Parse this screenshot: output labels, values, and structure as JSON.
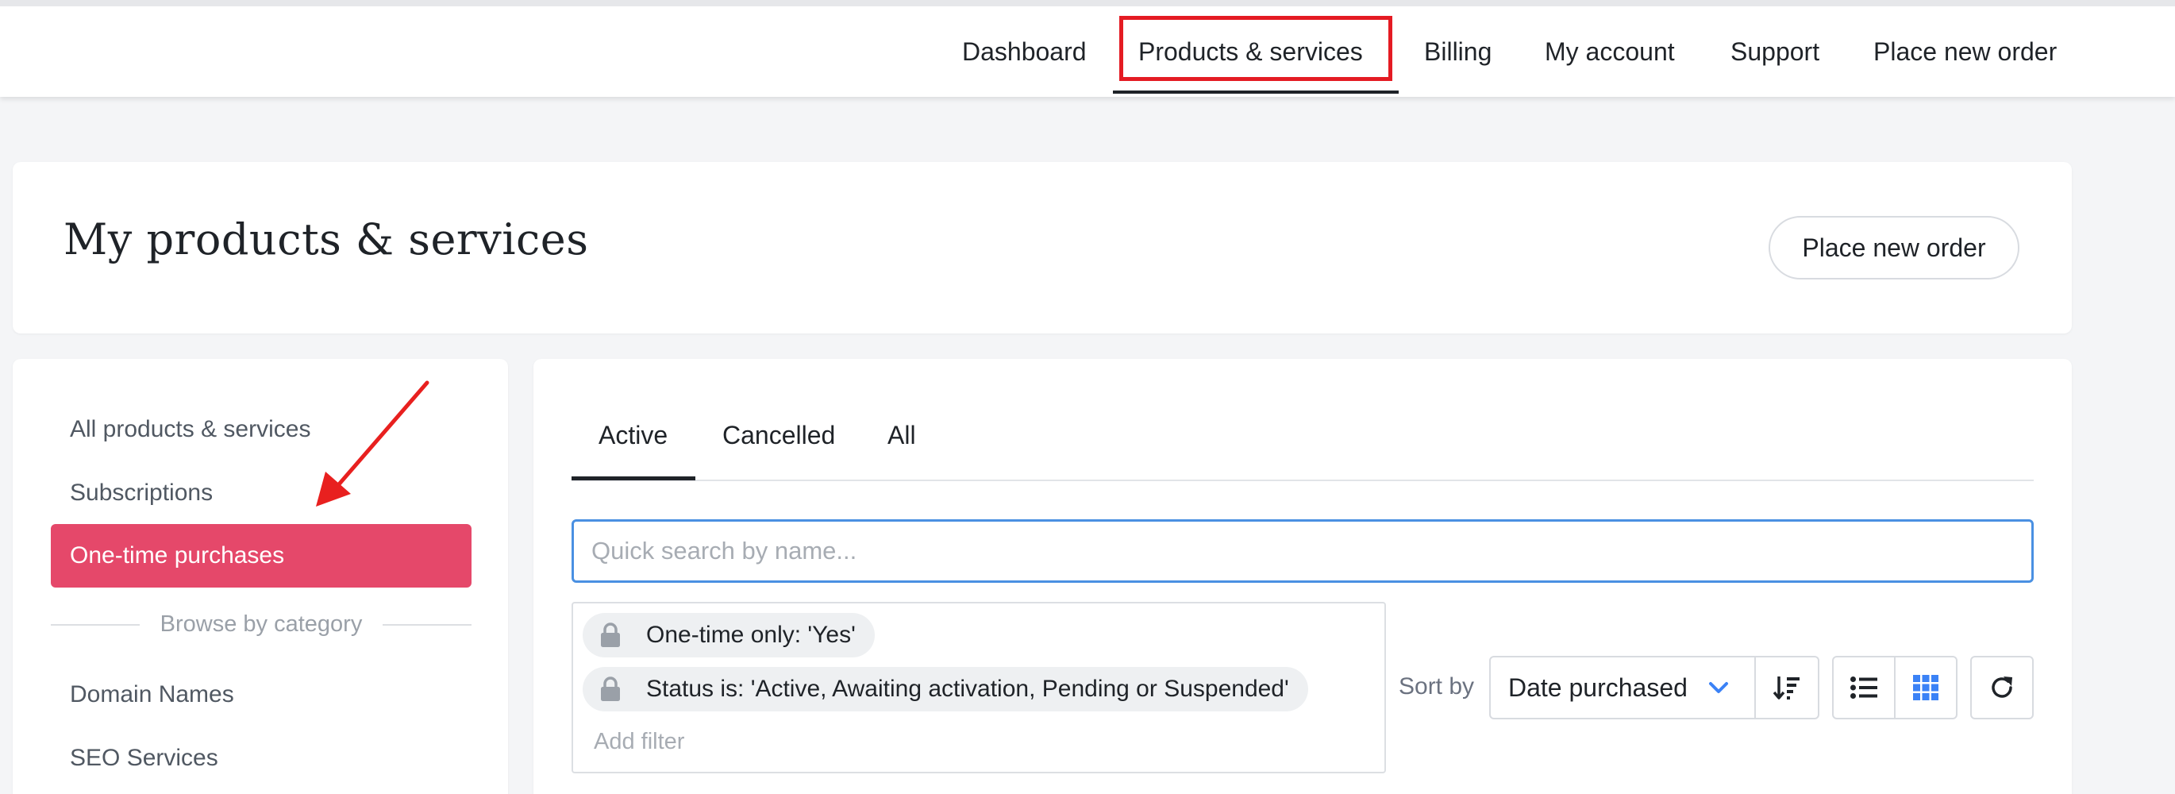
{
  "nav": {
    "items": [
      "Dashboard",
      "Products & services",
      "Billing",
      "My account",
      "Support",
      "Place new order"
    ]
  },
  "header": {
    "title": "My products & services",
    "place_order_label": "Place new order"
  },
  "sidebar": {
    "items": [
      "All products & services",
      "Subscriptions",
      "One-time purchases"
    ],
    "browse_label": "Browse by category",
    "categories": [
      "Domain Names",
      "SEO Services"
    ]
  },
  "tabs": [
    "Active",
    "Cancelled",
    "All"
  ],
  "search": {
    "placeholder": "Quick search by name..."
  },
  "filters": {
    "chips": [
      "One-time only: 'Yes'",
      "Status is: 'Active, Awaiting activation, Pending or Suspended'"
    ],
    "add_filter_label": "Add filter"
  },
  "sort": {
    "label": "Sort by",
    "selected": "Date purchased"
  },
  "colors": {
    "accent_pink": "#e5486a",
    "focus_blue": "#4a90e2",
    "highlight_red": "#e41b23",
    "annotation_arrow": "#e8201f"
  },
  "icons": [
    "lock-icon",
    "chevron-down-icon",
    "sort-order-icon",
    "list-view-icon",
    "grid-view-icon",
    "refresh-icon"
  ]
}
